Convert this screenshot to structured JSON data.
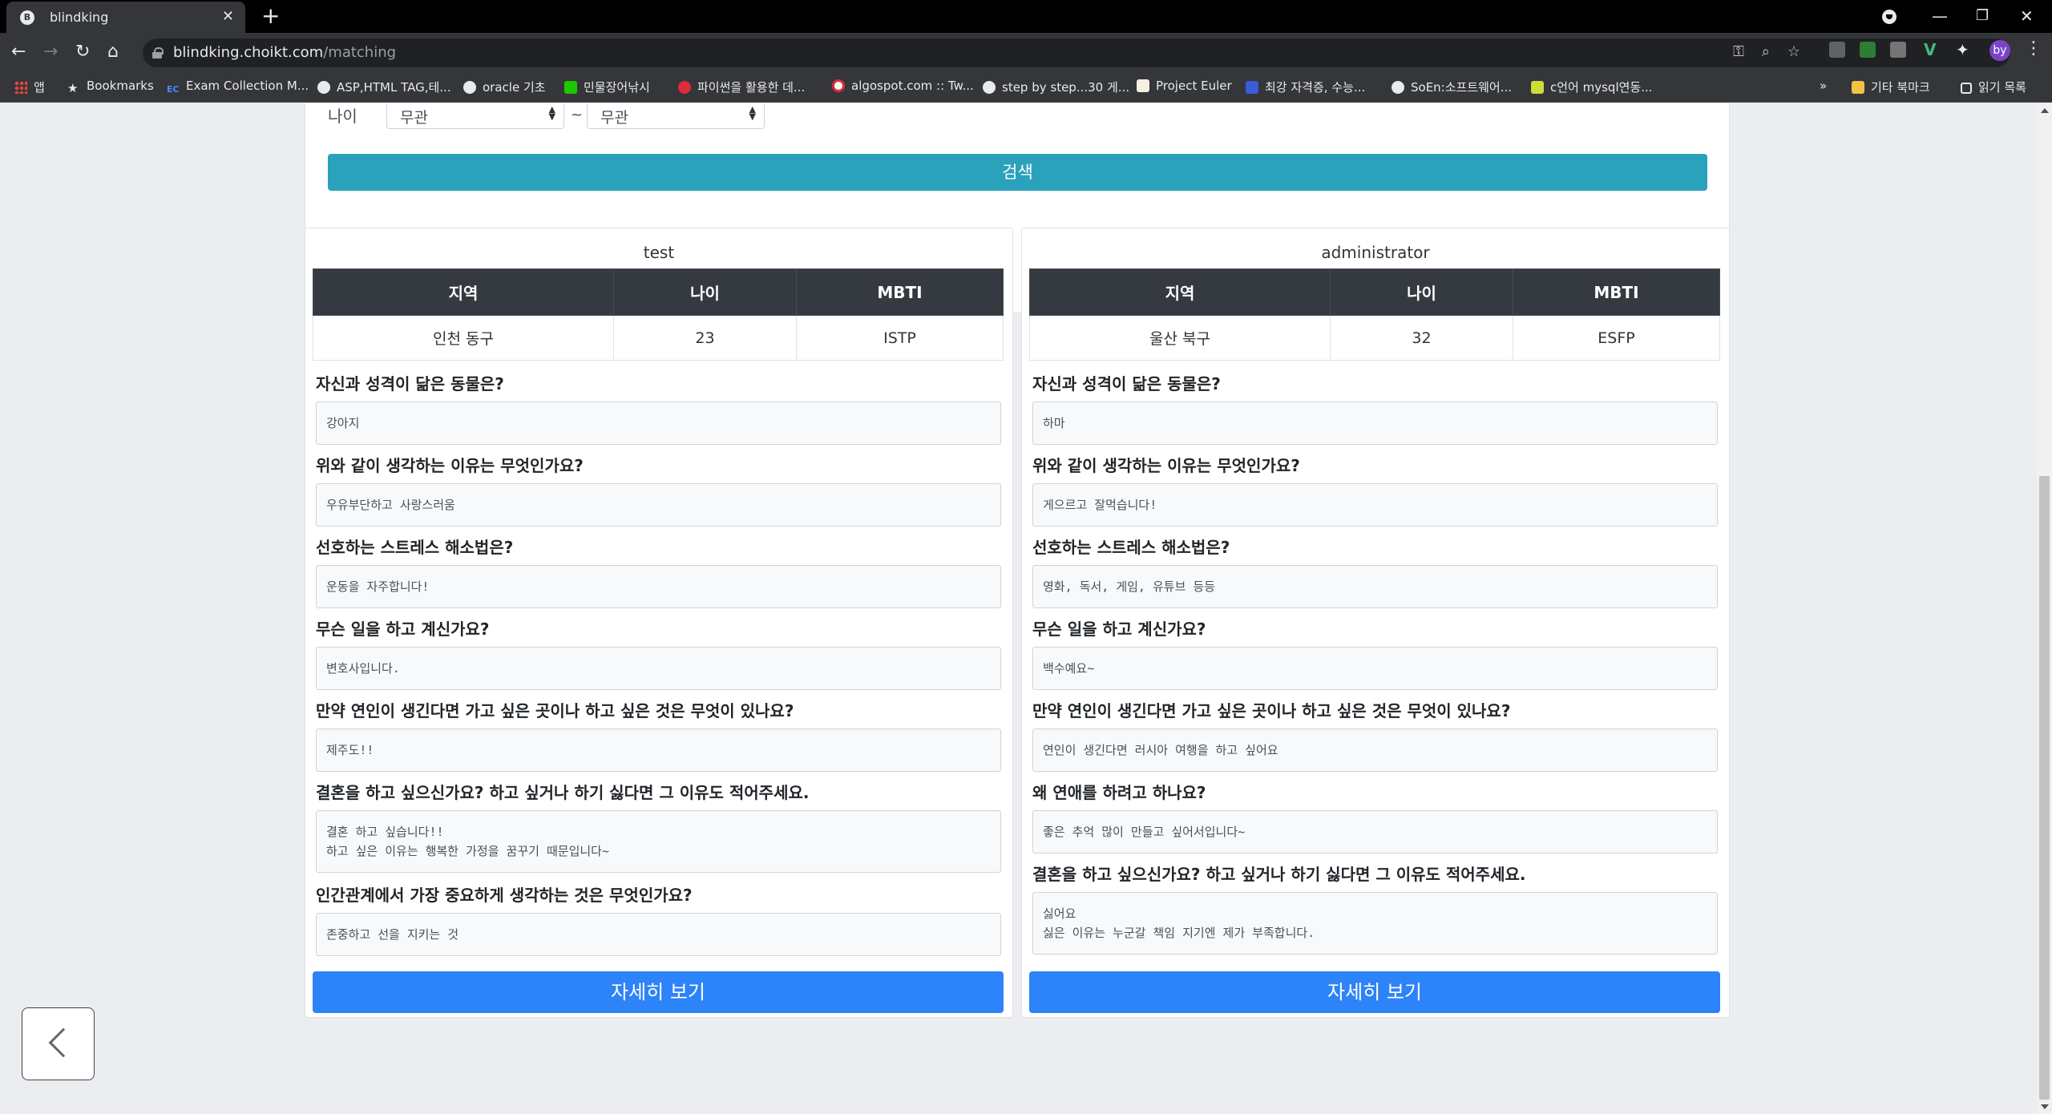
{
  "browser": {
    "tab_title": "blindking",
    "tab_favicon_letter": "B",
    "url_host": "blindking.choikt.com",
    "url_path": "/matching",
    "bookmarks": [
      "앱",
      "Bookmarks",
      "Exam Collection M...",
      "ASP,HTML TAG,테...",
      "oracle 기초",
      "민물장어낚시",
      "파이썬을 활용한 데...",
      "algospot.com :: Tw...",
      "step by step...30 게...",
      "Project Euler",
      "최강 자격증, 수능...",
      "SoEn:소프트웨어...",
      "c언어 mysql연동..."
    ],
    "bookmarks_overflow": "»",
    "other_bookmarks": "기타 북마크",
    "reading_list": "읽기 목록",
    "avatar_text": "by"
  },
  "search": {
    "age_label": "나이",
    "age_min": "무관",
    "age_sep": "~",
    "age_max": "무관",
    "button_label": "검색"
  },
  "table_headers": [
    "지역",
    "나이",
    "MBTI"
  ],
  "detail_button_label": "자세히 보기",
  "profiles": [
    {
      "name": "test",
      "region": "인천 동구",
      "age": "23",
      "mbti": "ISTP",
      "qa": [
        {
          "q": "자신과 성격이 닮은 동물은?",
          "a": "강아지"
        },
        {
          "q": "위와 같이 생각하는 이유는 무엇인가요?",
          "a": "우유부단하고 사랑스러움"
        },
        {
          "q": "선호하는 스트레스 해소법은?",
          "a": "운동을 자주합니다!"
        },
        {
          "q": "무슨 일을 하고 계신가요?",
          "a": "변호사입니다."
        },
        {
          "q": "만약 연인이 생긴다면 가고 싶은 곳이나 하고 싶은 것은 무엇이 있나요?",
          "a": "제주도!!"
        },
        {
          "q": "결혼을 하고 싶으신가요? 하고 싶거나 하기 싫다면 그 이유도 적어주세요.",
          "a": "결혼 하고 싶습니다!!\n하고 싶은 이유는 행복한 가정을 꿈꾸기 때문입니다~"
        },
        {
          "q": "인간관계에서 가장 중요하게 생각하는 것은 무엇인가요?",
          "a": "존중하고 선을 지키는 것"
        }
      ]
    },
    {
      "name": "administrator",
      "region": "울산 북구",
      "age": "32",
      "mbti": "ESFP",
      "qa": [
        {
          "q": "자신과 성격이 닮은 동물은?",
          "a": "하마"
        },
        {
          "q": "위와 같이 생각하는 이유는 무엇인가요?",
          "a": "게으르고 잘먹습니다!"
        },
        {
          "q": "선호하는 스트레스 해소법은?",
          "a": "영화, 독서, 게임, 유튜브 등등"
        },
        {
          "q": "무슨 일을 하고 계신가요?",
          "a": "백수예요~"
        },
        {
          "q": "만약 연인이 생긴다면 가고 싶은 곳이나 하고 싶은 것은 무엇이 있나요?",
          "a": "연인이 생긴다면 러시아 여행을 하고 싶어요"
        },
        {
          "q": "왜 연애를 하려고 하나요?",
          "a": "좋은 추억 많이 만들고 싶어서입니다~"
        },
        {
          "q": "결혼을 하고 싶으신가요? 하고 싶거나 하기 싫다면 그 이유도 적어주세요.",
          "a": "싫어요\n싫은 이유는 누군갈 책임 지기엔 제가 부족합니다."
        }
      ]
    }
  ],
  "colors": {
    "search_button": "#2aa2bc",
    "detail_button": "#2d83f8",
    "table_header": "#343a40"
  }
}
